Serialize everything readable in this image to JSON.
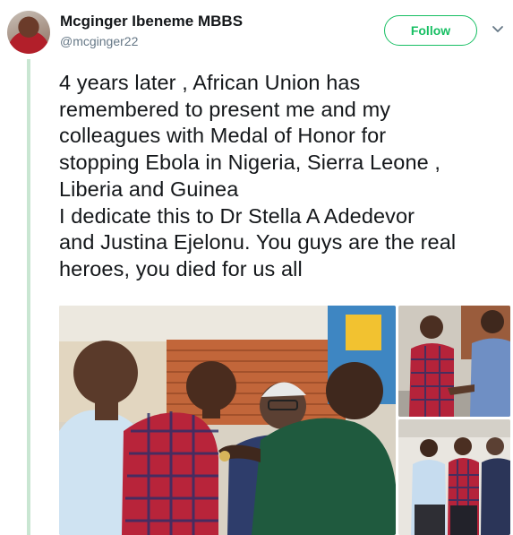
{
  "user": {
    "display_name": "Mcginger Ibeneme MBBS",
    "handle": "@mcginger22"
  },
  "actions": {
    "follow_label": "Follow",
    "more_icon": "chevron-down-icon"
  },
  "tweet": {
    "text": "4 years later , African Union has\nremembered to present me and my\ncolleagues with Medal of Honor for\nstopping Ebola in Nigeria, Sierra Leone ,\nLiberia and Guinea\nI dedicate this to Dr Stella A Adedevor\nand Justina Ejelonu. You guys are the real\nheroes, you died for us all"
  },
  "colors": {
    "follow_green": "#17bf63",
    "thread_line": "#c9e6d2",
    "text_primary": "#14171a",
    "text_secondary": "#657786"
  }
}
